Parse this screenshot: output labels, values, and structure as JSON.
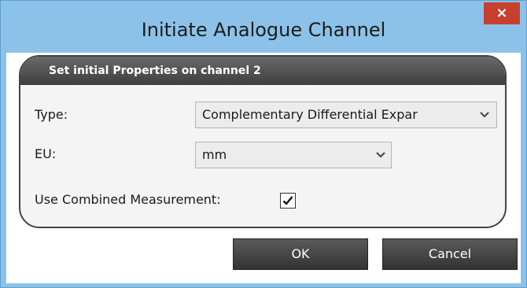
{
  "window": {
    "title": "Initiate Analogue Channel",
    "close_symbol": "×",
    "close_color": "#c7402f"
  },
  "group": {
    "title": "Set initial Properties on channel 2"
  },
  "form": {
    "type_label": "Type:",
    "type_value": "Complementary Differential Expar",
    "eu_label": "EU:",
    "eu_value": "mm",
    "combined_label": "Use Combined Measurement:",
    "combined_checked": true
  },
  "buttons": {
    "ok_label": "OK",
    "cancel_label": "Cancel"
  },
  "icons": {
    "close": "close-icon",
    "dropdown": "chevron-down-icon",
    "check": "checkmark-icon"
  }
}
